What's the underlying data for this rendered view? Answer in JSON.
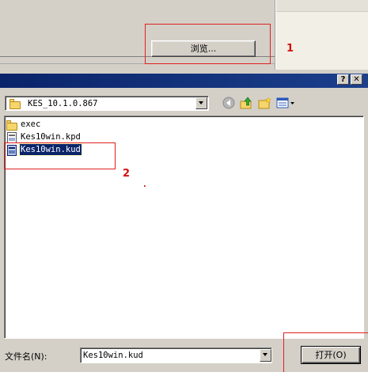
{
  "background": {
    "browse_label": "浏览..."
  },
  "annotations": {
    "step1": "1",
    "step2": "2",
    "dot": "."
  },
  "dialog": {
    "help_label": "?",
    "close_label": "✕",
    "location": "KES_10.1.0.867",
    "files": [
      {
        "name": "exec",
        "icon": "folder-icon"
      },
      {
        "name": "Kes10win.kpd",
        "icon": "document-icon"
      },
      {
        "name": "Kes10win.kud",
        "icon": "document-icon",
        "selected": true
      }
    ],
    "filename_label": "文件名(N):",
    "filename_value": "Kes10win.kud",
    "open_label": "打开(O)"
  },
  "colors": {
    "title_bar": "#0a246a",
    "annotation_red": "#e02020",
    "selection": "#0a246a"
  }
}
